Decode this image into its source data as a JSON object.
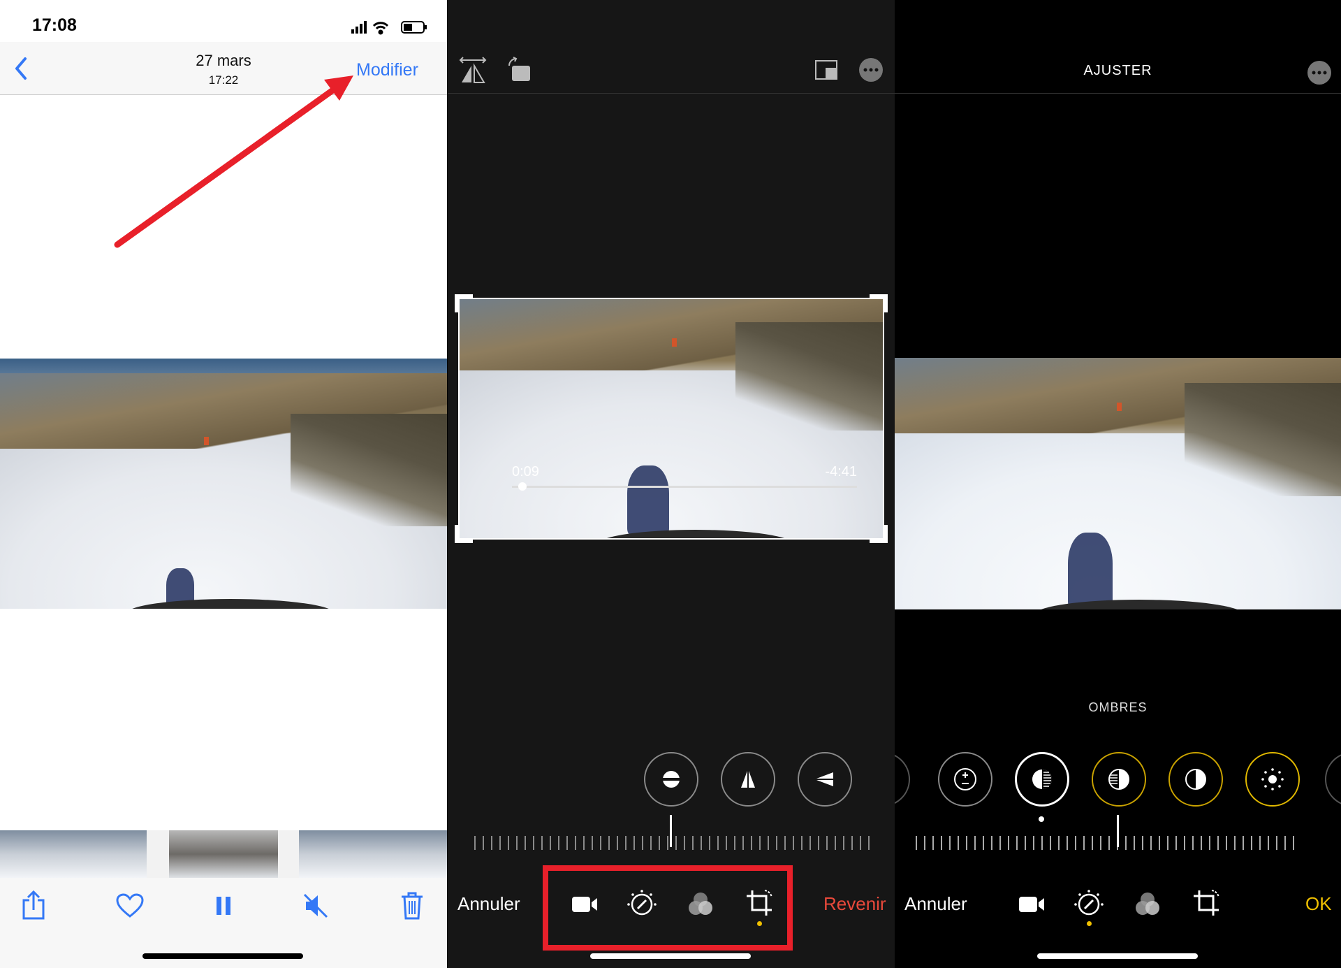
{
  "panel1": {
    "status": {
      "time": "17:08"
    },
    "nav": {
      "date": "27 mars",
      "time": "17:22",
      "edit_label": "Modifier"
    },
    "annotation": {
      "arrow_color": "#e8202a"
    },
    "toolbar": {
      "share": "share-icon",
      "favorite": "heart-icon",
      "pause": "pause-icon",
      "mute": "speaker-muted-icon",
      "delete": "trash-icon"
    }
  },
  "panel2": {
    "video": {
      "elapsed": "0:09",
      "remaining": "-4:41",
      "progress": 0.03
    },
    "bottom": {
      "cancel_label": "Annuler",
      "revert_label": "Revenir"
    },
    "highlight_color": "#e8202a",
    "revert_color": "#e8493b"
  },
  "panel3": {
    "header": {
      "title": "AJUSTER"
    },
    "adjust": {
      "current": "OMBRES"
    },
    "bottom": {
      "cancel_label": "Annuler",
      "ok_label": "OK"
    },
    "accent_color": "#f0c000"
  }
}
